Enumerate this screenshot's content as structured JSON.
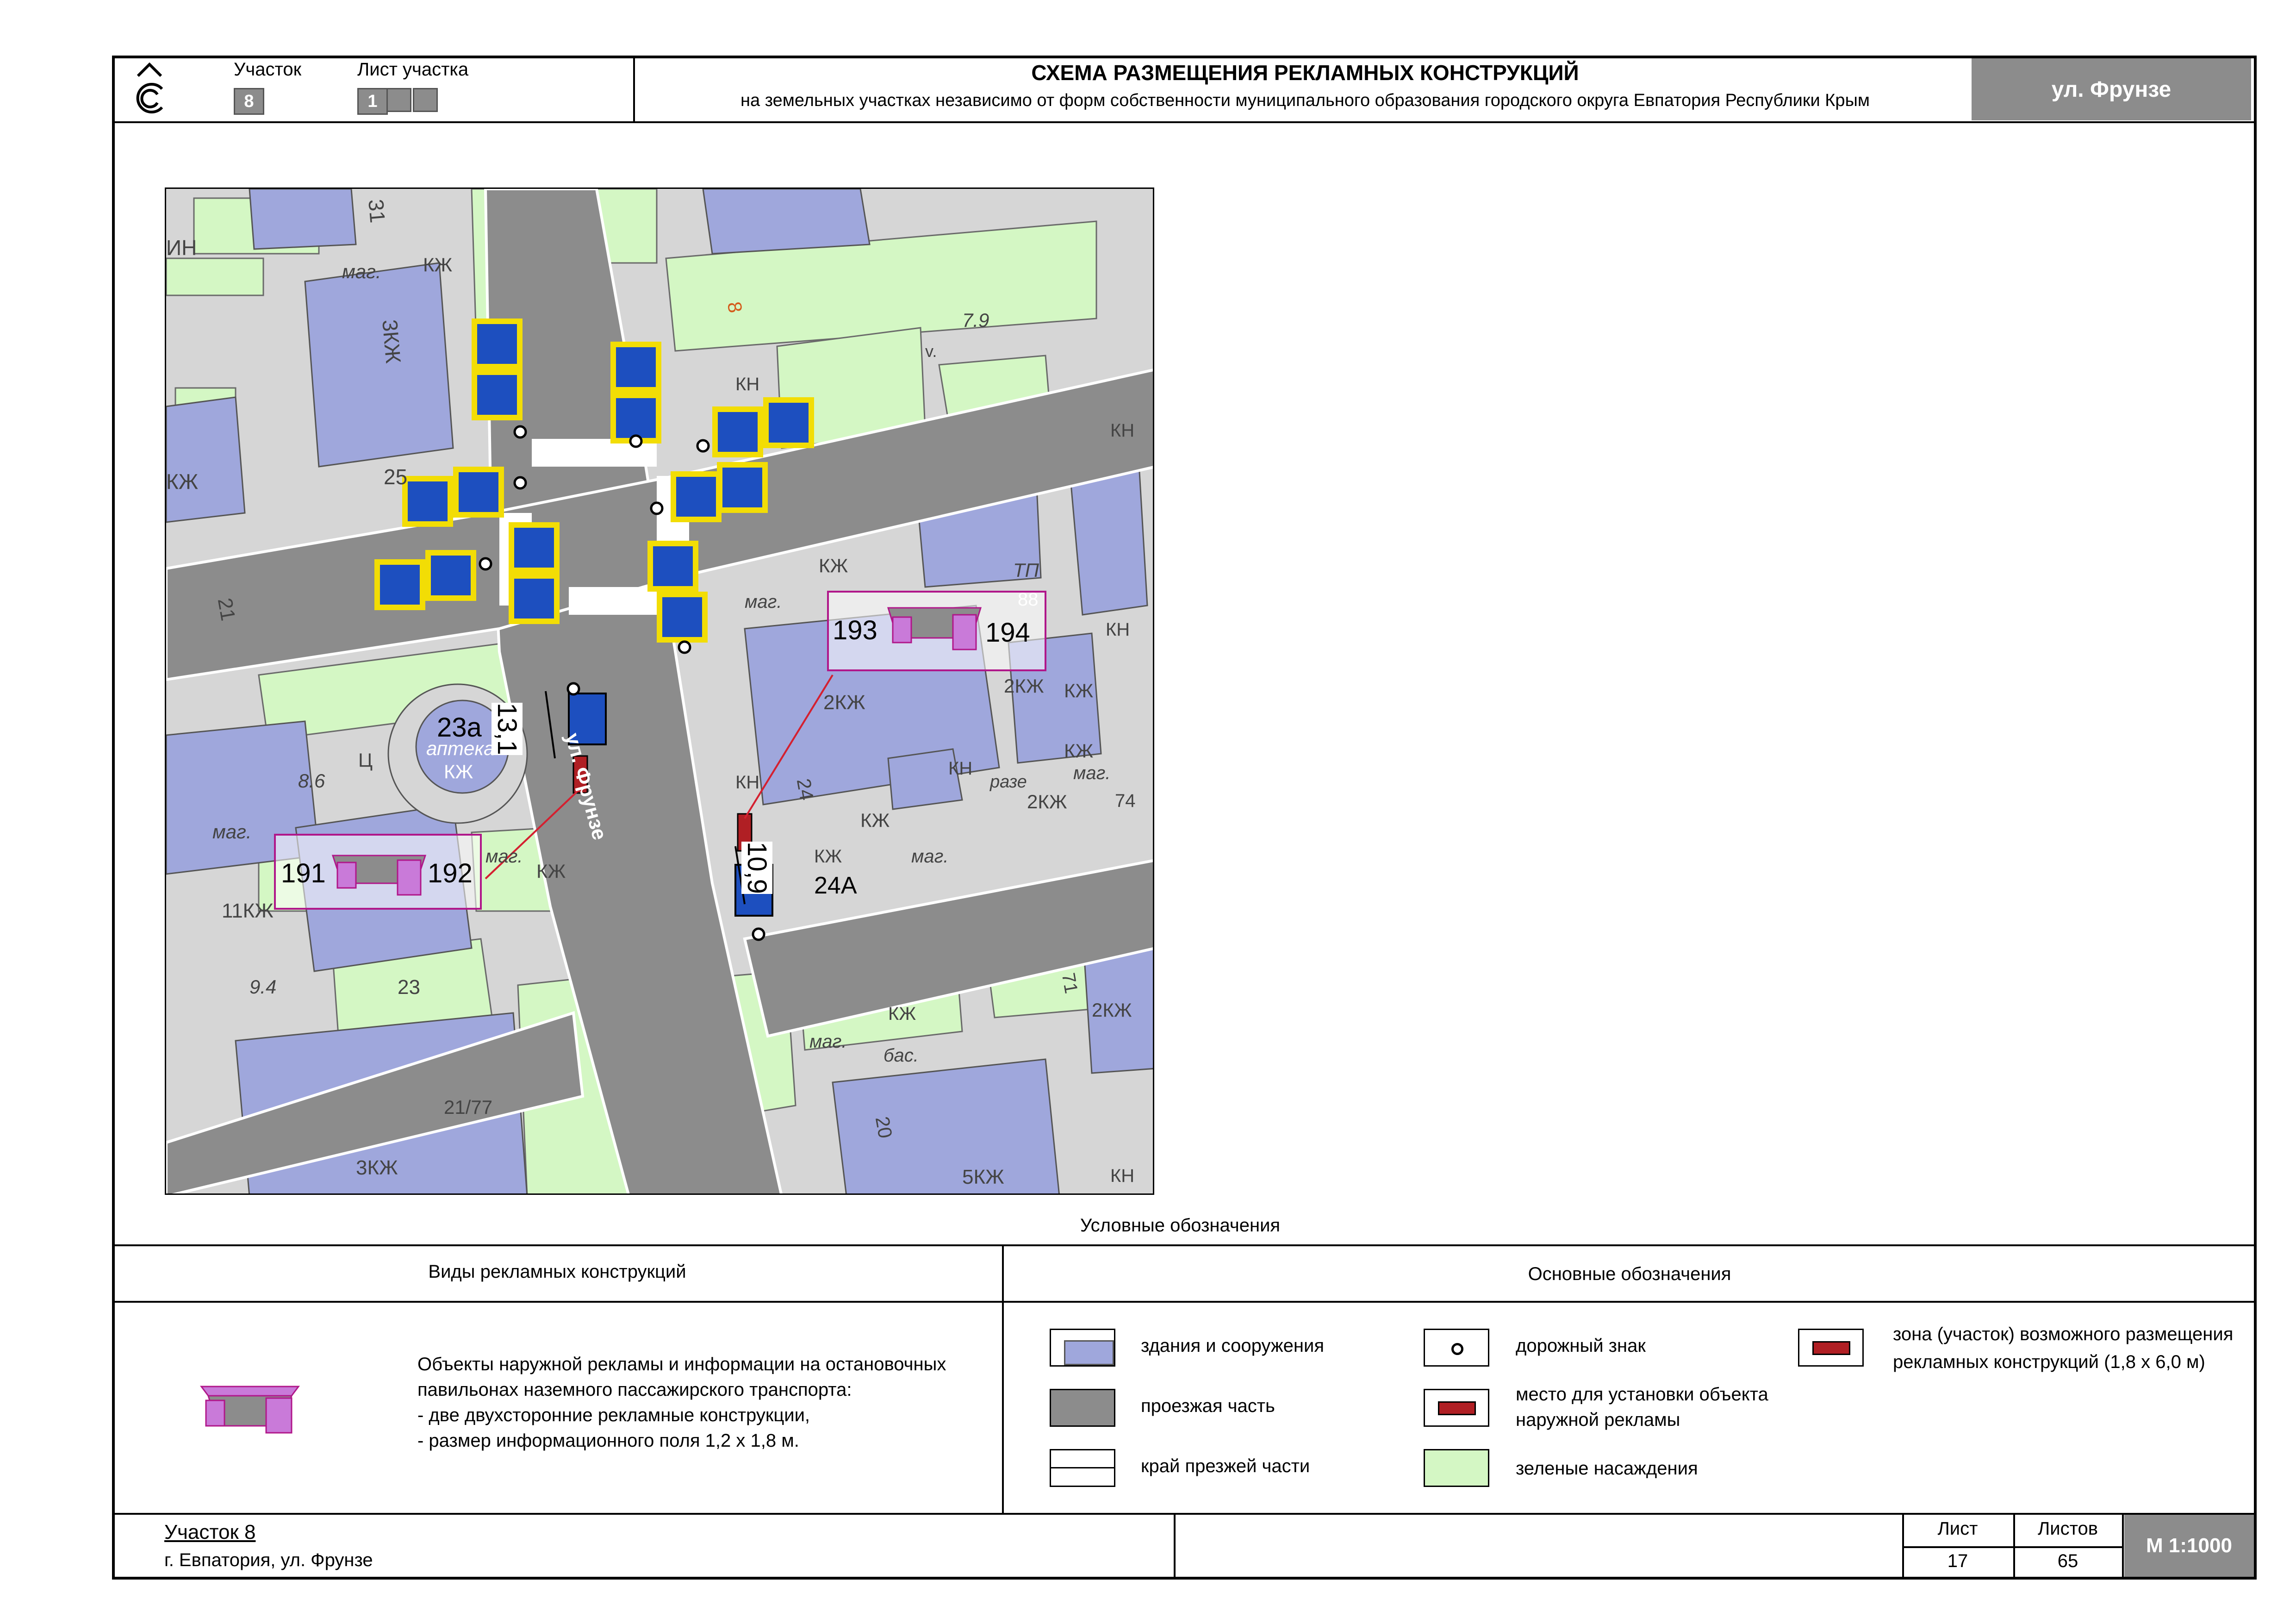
{
  "header": {
    "plot_label": "Участок",
    "plot_number": "8",
    "sheet_label": "Лист участка",
    "sheet_number": "1",
    "title": "СХЕМА РАЗМЕЩЕНИЯ РЕКЛАМНЫХ КОНСТРУКЦИЙ",
    "subtitle": "на земельных участках независимо от форм собственности муниципального образования городского округа Евпатория Республики Крым",
    "street_badge": "ул. Фрунзе"
  },
  "map": {
    "street_label": "ул. Фрунзе",
    "distance_1": "13,1",
    "distance_2": "10,9",
    "pavilions": [
      {
        "left_id": "191",
        "right_id": "192"
      },
      {
        "left_id": "193",
        "right_id": "194"
      }
    ],
    "labels": {
      "l1": "31",
      "l2": "3КЖ",
      "l3": "маг.",
      "l4": "КЖ",
      "l5": "25",
      "l6": "КЖ",
      "l7": "ИН",
      "l8": "21",
      "l9": "23а",
      "l10": "аптека",
      "l11": "КЖ",
      "l12": "Ц",
      "l13": "8.6",
      "l14": "маг.",
      "l15": "11КЖ",
      "l16": "9.4",
      "l17": "23",
      "l18": "21/77",
      "l19": "3КЖ",
      "l20": "маг.",
      "l21": "КЖ",
      "l22": "7.9",
      "l23": "КН",
      "l24": "ТП",
      "l25": "88",
      "l26": "КЖ",
      "l27": "маг.",
      "l28": "2КЖ",
      "l29": "2КЖ",
      "l30": "КЖ",
      "l31": "КН",
      "l32": "КЖ",
      "l33": "маг.",
      "l34": "2КЖ",
      "l35": "74",
      "l36": "КН",
      "l37": "разе",
      "l38": "24",
      "l39": "КЖ",
      "l40": "КЖ",
      "l41": "маг.",
      "l42": "24А",
      "l43": "КН",
      "l44": "КЖ",
      "l45": "71",
      "l46": "2КЖ",
      "l47": "бас.",
      "l48": "маг.",
      "l49": "20",
      "l50": "5КЖ",
      "l51": "КН",
      "l52": "8",
      "l53": "КН",
      "l54": "v."
    }
  },
  "legend": {
    "title": "Условные обозначения",
    "types_header": "Виды рекламных конструкций",
    "main_header": "Основные обозначения",
    "pavilion_description": [
      "Объекты наружной рекламы и информации на остановочных",
      "павильонах наземного пассажирского транспорта:",
      "- две двухсторонние рекламные конструкции,",
      "- размер информационного поля 1,2 х 1,8 м."
    ],
    "items": {
      "buildings": "здания и сооружения",
      "roadway": "проезжая часть",
      "road_edge": "край презжей части",
      "road_sign": "дорожный знак",
      "ad_place_line1": "место для установки объекта",
      "ad_place_line2": "наружной рекламы",
      "greenery": "зеленые насаждения",
      "zone_line1": "зона (участок) возможного размещения",
      "zone_line2": "рекламных конструкций (1,8 х 6,0 м)"
    }
  },
  "footer": {
    "plot_title": "Участок 8",
    "address": "г. Евпатория, ул. Фрунзе",
    "sheet_label": "Лист",
    "sheet_value": "17",
    "sheets_label": "Листов",
    "sheets_value": "65",
    "scale": "М 1:1000"
  },
  "colors": {
    "building": "#9fa7dc",
    "roadway": "#8c8c8c",
    "greenery": "#d4f7c4",
    "ground": "#d6d6d6",
    "ad_place": "#b01f24",
    "pavilion": "#c97ad9",
    "pavilion_frame": "#b0178a",
    "sign_blue": "#1d4fbf",
    "sign_yellow": "#f2dd05"
  }
}
